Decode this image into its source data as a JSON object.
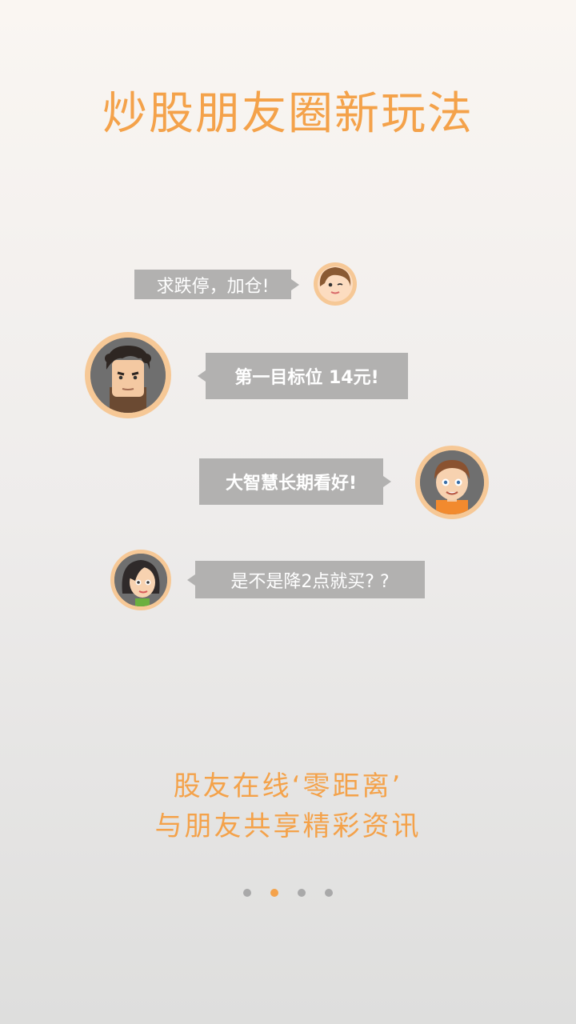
{
  "title": "炒股朋友圈新玩法",
  "messages": [
    {
      "text": "求跌停，加仓!",
      "avatar": "woman-winking-avatar"
    },
    {
      "text": "第一目标位 14元!",
      "avatar": "man-curly-hair-avatar"
    },
    {
      "text": "大智慧长期看好!",
      "avatar": "boy-orange-shirt-avatar"
    },
    {
      "text": "是不是降2点就买? ?",
      "avatar": "woman-dark-hair-avatar"
    }
  ],
  "footer": {
    "line1": "股友在线‘零距离’",
    "line2": "与朋友共享精彩资讯"
  },
  "pagination": {
    "total": 4,
    "active_index": 1
  },
  "colors": {
    "accent": "#f4a24a",
    "bubble": "#b2b1b0",
    "avatar_ring": "#f6c896",
    "dot_inactive": "#a9a9a9"
  }
}
